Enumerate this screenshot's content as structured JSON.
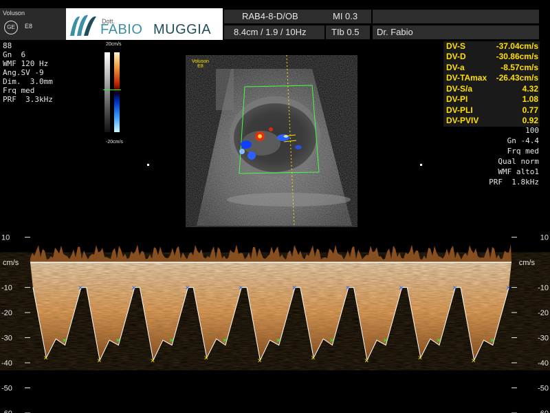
{
  "header": {
    "brand": "Voluson",
    "ge_logo": "GE",
    "model": "E8",
    "logo": {
      "prefix": "Dott.",
      "first": "FABIO",
      "last": "MUGGIA"
    },
    "probe": "RAB4-8-D/OB",
    "mi": "MI  0.3",
    "scan": "8.4cm / 1.9 / 10Hz",
    "tib": "TIb  0.5",
    "operator": "Dr. Fabio"
  },
  "left_params": [
    "88",
    "Gn  6",
    "WMF 120 Hz",
    "Ang.SV -9",
    "Dim.  3.0mm",
    "Frq med",
    "PRF  3.3kHz"
  ],
  "color_scale": {
    "top": "20cm/s",
    "bottom": "-20cm/s"
  },
  "image_label": {
    "line1": "Voluson",
    "line2": "E8"
  },
  "measurements": [
    {
      "label": "DV-S",
      "value": "-37.04cm/s"
    },
    {
      "label": "DV-D",
      "value": "-30.86cm/s"
    },
    {
      "label": "DV-a",
      "value": "-8.57cm/s"
    },
    {
      "label": "DV-TAmax",
      "value": "-26.43cm/s"
    },
    {
      "label": "DV-S/a",
      "value": "4.32"
    },
    {
      "label": "DV-PI",
      "value": "1.08"
    },
    {
      "label": "DV-PLI",
      "value": "0.77"
    },
    {
      "label": "DV-PVIV",
      "value": "0.92"
    }
  ],
  "right_params": [
    "100",
    "Gn -4.4",
    "Frq med",
    "Qual norm",
    "WMF alto1",
    "PRF  1.8kHz"
  ],
  "doppler": {
    "unit": "cm/s",
    "ticks": [
      10,
      -10,
      -20,
      -30,
      -40,
      -50,
      -60
    ],
    "ylim": [
      14,
      -60
    ],
    "baseline": 0,
    "cycles": [
      {
        "s_peak": -38,
        "a_wave": -10,
        "d_mark": -31
      },
      {
        "s_peak": -39,
        "a_wave": -10,
        "d_mark": -31
      },
      {
        "s_peak": -39,
        "a_wave": -10,
        "d_mark": -31
      },
      {
        "s_peak": -38,
        "a_wave": -10,
        "d_mark": -31
      },
      {
        "s_peak": -39,
        "a_wave": -10,
        "d_mark": -31
      },
      {
        "s_peak": -38,
        "a_wave": -10,
        "d_mark": -31
      },
      {
        "s_peak": -39,
        "a_wave": -10,
        "d_mark": -31
      },
      {
        "s_peak": -38,
        "a_wave": -10,
        "d_mark": -31
      },
      {
        "s_peak": -39,
        "a_wave": -10,
        "d_mark": -31
      }
    ],
    "colors": {
      "spectrum": "#f2b277",
      "envelope": "#ffffff",
      "s_marker": "#ffe000",
      "d_marker": "#1aff3a",
      "a_marker": "#1560ff"
    }
  }
}
